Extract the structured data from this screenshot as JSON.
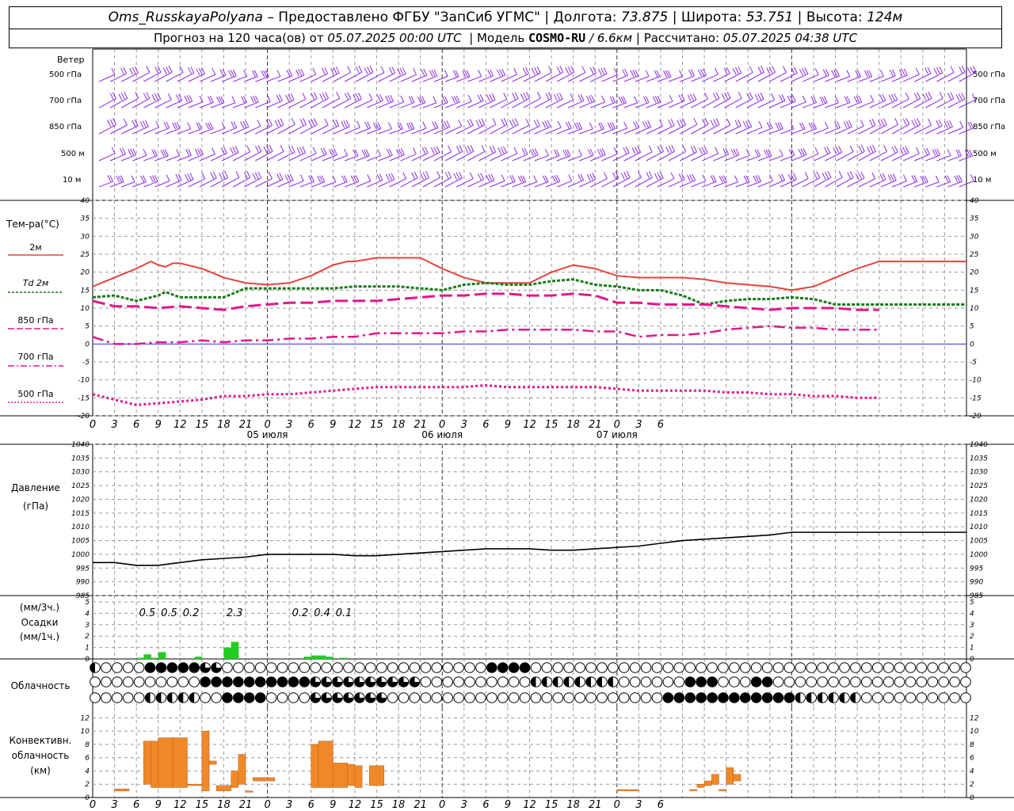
{
  "header": {
    "station": "Oms_RusskayaPolyana",
    "provider": "– Предоставлено ФГБУ \"ЗапСиб УГМС\"",
    "lon_label": "Долгота:",
    "lon_value": "73.875",
    "lat_label": "Широта:",
    "lat_value": "53.751",
    "alt_label": "Высота:",
    "alt_value": "124м",
    "forecast_prefix": "Прогноз на 120 часа(ов) от",
    "forecast_start": "05.07.2025 00:00 UTC",
    "model_label": "Модель",
    "model_name": "COSMO-RU",
    "model_res": "/ 6.6км",
    "calc_label": "Рассчитано:",
    "calc_time": "05.07.2025 04:38 UTC"
  },
  "panels": {
    "wind_title": "Ветер",
    "wind_levels": [
      "500 гПа",
      "700 гПа",
      "850 гПа",
      "500 м",
      "10 м"
    ],
    "temp_title": "Тем-ра(°C)",
    "temp_legend": [
      "2м",
      "Td 2м",
      "850 гПа",
      "700 гПа",
      "500 гПа"
    ],
    "pressure_title": "Давление",
    "pressure_unit": "(гПа)",
    "precip_unit1": "(мм/3ч.)",
    "precip_title": "Осадки",
    "precip_unit2": "(мм/1ч.)",
    "cloud_title": "Облачность",
    "conv_title1": "Конвективн.",
    "conv_title2": "облачность",
    "conv_unit": "(км)"
  },
  "axis": {
    "hour_labels": [
      "0",
      "3",
      "6",
      "9",
      "12",
      "15",
      "18",
      "21",
      "0",
      "3",
      "6",
      "9",
      "12",
      "15",
      "18",
      "21",
      "0",
      "3",
      "6",
      "9",
      "12",
      "15",
      "18",
      "21",
      "0",
      "3",
      "6"
    ],
    "day_labels": [
      "05 июля",
      "06 июля",
      "07 июля"
    ]
  },
  "colors": {
    "t2m": "#e8413c",
    "td2m": "#1a7a1a",
    "t850": "#e0188c",
    "t700": "#e0188c",
    "t500": "#e0188c",
    "wind": "#8a2be2",
    "precip": "#22cc22",
    "conv": "#f0882a",
    "grid": "#9a9a9a"
  },
  "chart_data": [
    {
      "type": "line",
      "title": "Тем-ра(°C)",
      "x_unit": "hours from 05.07.2025 00:00 UTC",
      "ylim": [
        -20,
        40
      ],
      "series": [
        {
          "name": "2м",
          "x": [
            0,
            3,
            6,
            8,
            9,
            10,
            11,
            12,
            15,
            18,
            21,
            24,
            27,
            30,
            33,
            35,
            36,
            39,
            42,
            45,
            48,
            51,
            54,
            57,
            60,
            63,
            66,
            69,
            72,
            75,
            78,
            81,
            84,
            87,
            90,
            93,
            96,
            99,
            102,
            105,
            108,
            111,
            114,
            117,
            120
          ],
          "values": [
            16,
            18.5,
            21,
            23,
            22,
            21.5,
            22.5,
            22.5,
            21,
            18.5,
            17,
            16.5,
            17,
            19,
            22,
            23,
            23,
            24,
            24,
            24,
            21,
            18.5,
            17,
            17,
            17,
            20,
            22,
            21,
            19,
            18.5,
            18.5,
            18.5,
            18,
            17,
            16.5,
            16,
            15,
            16,
            18.5,
            21,
            23,
            23,
            23,
            23,
            23
          ]
        },
        {
          "name": "Td 2м",
          "x": [
            0,
            3,
            6,
            9,
            10,
            12,
            15,
            18,
            21,
            24,
            27,
            30,
            33,
            36,
            39,
            42,
            45,
            48,
            51,
            54,
            57,
            60,
            63,
            66,
            69,
            72,
            75,
            78,
            81,
            84,
            87,
            90,
            93,
            96,
            99,
            102,
            105,
            108,
            111,
            114,
            117,
            120
          ],
          "values": [
            13,
            13.5,
            12,
            13.5,
            14.5,
            13,
            13,
            13,
            15.5,
            15.5,
            15.5,
            15.5,
            15.5,
            16,
            16,
            16,
            15.5,
            15,
            16.5,
            17,
            16.5,
            16.5,
            17.5,
            18,
            16.5,
            16,
            15,
            15,
            13.5,
            11,
            12,
            12.5,
            12.5,
            13,
            12.5,
            11,
            11,
            11,
            11,
            11,
            11,
            11
          ]
        },
        {
          "name": "850 гПа",
          "x": [
            0,
            3,
            6,
            9,
            12,
            15,
            18,
            21,
            24,
            27,
            30,
            33,
            36,
            39,
            42,
            45,
            48,
            51,
            54,
            57,
            60,
            63,
            66,
            69,
            72,
            75,
            78,
            81,
            84,
            87,
            90,
            93,
            96,
            99,
            102,
            105,
            108
          ],
          "values": [
            12,
            10.5,
            10.5,
            10,
            10.5,
            10,
            9.5,
            10.5,
            11,
            11.5,
            11.5,
            12,
            12,
            12,
            12.5,
            13,
            13.5,
            13.5,
            14,
            14,
            13.5,
            13.5,
            14,
            13.5,
            11.5,
            11.5,
            11,
            11,
            11,
            10.5,
            10,
            9.5,
            10,
            10,
            10,
            9.5,
            9.5
          ]
        },
        {
          "name": "700 гПа",
          "x": [
            0,
            3,
            6,
            9,
            12,
            15,
            18,
            21,
            24,
            27,
            30,
            33,
            36,
            39,
            42,
            45,
            48,
            51,
            54,
            57,
            60,
            63,
            66,
            69,
            72,
            75,
            78,
            81,
            84,
            87,
            90,
            93,
            96,
            99,
            102,
            105,
            108
          ],
          "values": [
            2,
            0,
            0,
            0.5,
            0.5,
            1,
            0.5,
            1,
            1,
            1.5,
            1.5,
            2,
            2,
            3,
            3,
            3,
            3,
            3.5,
            3.5,
            4,
            4,
            4,
            4,
            3.5,
            3.5,
            2,
            2.5,
            2.5,
            3,
            4,
            4.5,
            5,
            4.5,
            4.5,
            4,
            4,
            4
          ]
        },
        {
          "name": "500 гПа",
          "x": [
            0,
            3,
            6,
            9,
            12,
            15,
            18,
            21,
            24,
            27,
            30,
            33,
            36,
            39,
            42,
            45,
            48,
            51,
            54,
            57,
            60,
            63,
            66,
            69,
            72,
            75,
            78,
            81,
            84,
            87,
            90,
            93,
            96,
            99,
            102,
            105,
            108
          ],
          "values": [
            -14,
            -15.5,
            -17,
            -16.5,
            -16,
            -15.5,
            -14.5,
            -14.5,
            -14,
            -14,
            -13.5,
            -13,
            -12.5,
            -12,
            -12,
            -12,
            -12,
            -12,
            -11.5,
            -12,
            -12,
            -12,
            -12,
            -12,
            -12.5,
            -13,
            -13,
            -13,
            -13,
            -13.5,
            -13.5,
            -14,
            -14,
            -14.5,
            -14.5,
            -15,
            -15
          ]
        }
      ]
    },
    {
      "type": "line",
      "title": "Давление",
      "ylabel": "(гПа)",
      "ylim": [
        985,
        1040
      ],
      "series": [
        {
          "name": "Давление",
          "x": [
            0,
            3,
            6,
            9,
            12,
            15,
            18,
            21,
            24,
            27,
            30,
            33,
            36,
            39,
            42,
            45,
            48,
            51,
            54,
            57,
            60,
            63,
            66,
            69,
            72,
            75,
            78,
            81,
            84,
            87,
            90,
            93,
            96,
            99,
            102,
            105,
            108,
            111,
            114,
            117,
            120
          ],
          "values": [
            997,
            997,
            996,
            996,
            997,
            998,
            998.5,
            999,
            1000,
            1000,
            1000,
            1000,
            999.5,
            999.5,
            1000,
            1000.5,
            1001,
            1001.5,
            1002,
            1002,
            1002,
            1001.5,
            1001.5,
            1002,
            1002.5,
            1003,
            1004,
            1005,
            1005.5,
            1006,
            1006.5,
            1007,
            1008,
            1008,
            1008,
            1008,
            1008,
            1008,
            1008,
            1008,
            1008
          ]
        }
      ]
    },
    {
      "type": "bar",
      "title": "Осадки",
      "ylim": [
        0,
        5
      ],
      "labels": [
        {
          "x": 7.5,
          "text": "0.5"
        },
        {
          "x": 10.5,
          "text": "0.5"
        },
        {
          "x": 13.5,
          "text": "0.2"
        },
        {
          "x": 19.5,
          "text": "2.3"
        },
        {
          "x": 28.5,
          "text": "0.2"
        },
        {
          "x": 31.5,
          "text": "0.4"
        },
        {
          "x": 34.5,
          "text": "0.1"
        }
      ],
      "bars": [
        {
          "x": 6,
          "value": 0.1
        },
        {
          "x": 7,
          "value": 0.4
        },
        {
          "x": 8,
          "value": 0.1
        },
        {
          "x": 9,
          "value": 0.6
        },
        {
          "x": 14,
          "value": 0.2
        },
        {
          "x": 18,
          "value": 1.0
        },
        {
          "x": 19,
          "value": 1.5
        },
        {
          "x": 29,
          "value": 0.2
        },
        {
          "x": 30,
          "value": 0.3
        },
        {
          "x": 31,
          "value": 0.3
        },
        {
          "x": 32,
          "value": 0.2
        },
        {
          "x": 34,
          "value": 0.1
        }
      ]
    },
    {
      "type": "bar",
      "title": "Конвективн. облачность (км)",
      "ylim": [
        0,
        13
      ],
      "ranges": [
        {
          "x0": 3,
          "x1": 5,
          "bottom": 1,
          "top": 1.3
        },
        {
          "x0": 7,
          "x1": 8,
          "bottom": 2,
          "top": 8.5
        },
        {
          "x0": 8,
          "x1": 9,
          "bottom": 1.5,
          "top": 8.5
        },
        {
          "x0": 9,
          "x1": 11,
          "bottom": 1.5,
          "top": 9
        },
        {
          "x0": 11,
          "x1": 13,
          "bottom": 1.5,
          "top": 9
        },
        {
          "x0": 13,
          "x1": 14,
          "bottom": 1.8,
          "top": 2
        },
        {
          "x0": 14,
          "x1": 15,
          "bottom": 1.8,
          "top": 2
        },
        {
          "x0": 15,
          "x1": 16,
          "bottom": 1,
          "top": 10
        },
        {
          "x0": 16,
          "x1": 17,
          "bottom": 5,
          "top": 5.5
        },
        {
          "x0": 17,
          "x1": 19,
          "bottom": 1,
          "top": 1.8
        },
        {
          "x0": 19,
          "x1": 20,
          "bottom": 1.5,
          "top": 4
        },
        {
          "x0": 20,
          "x1": 21,
          "bottom": 2,
          "top": 6.5
        },
        {
          "x0": 21,
          "x1": 22,
          "bottom": 0.8,
          "top": 1
        },
        {
          "x0": 22,
          "x1": 25,
          "bottom": 2.5,
          "top": 3
        },
        {
          "x0": 30,
          "x1": 31,
          "bottom": 1.5,
          "top": 8
        },
        {
          "x0": 31,
          "x1": 33,
          "bottom": 1.5,
          "top": 8.5
        },
        {
          "x0": 33,
          "x1": 35,
          "bottom": 1.5,
          "top": 5.2
        },
        {
          "x0": 35,
          "x1": 36,
          "bottom": 1.8,
          "top": 5
        },
        {
          "x0": 36,
          "x1": 37,
          "bottom": 1.5,
          "top": 4.8
        },
        {
          "x0": 38,
          "x1": 40,
          "bottom": 1.8,
          "top": 4.8
        },
        {
          "x0": 72,
          "x1": 75,
          "bottom": 1,
          "top": 1.2
        },
        {
          "x0": 82,
          "x1": 83,
          "bottom": 1,
          "top": 1.2
        },
        {
          "x0": 83,
          "x1": 84,
          "bottom": 1.5,
          "top": 2
        },
        {
          "x0": 84,
          "x1": 85,
          "bottom": 1.8,
          "top": 2.5
        },
        {
          "x0": 85,
          "x1": 86,
          "bottom": 2,
          "top": 3.5
        },
        {
          "x0": 86,
          "x1": 87,
          "bottom": 1,
          "top": 1.2
        },
        {
          "x0": 87,
          "x1": 88,
          "bottom": 2,
          "top": 4.5
        },
        {
          "x0": 88,
          "x1": 89,
          "bottom": 2.5,
          "top": 3.5
        }
      ]
    }
  ]
}
